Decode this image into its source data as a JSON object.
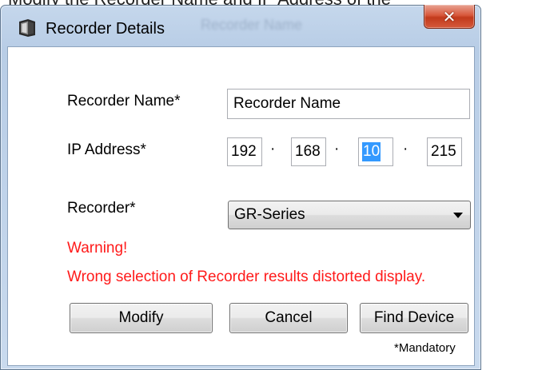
{
  "window": {
    "title": "Recorder Details",
    "close_glyph": "✕",
    "background_title": "Recorder Name"
  },
  "top_strip_text": "Modify the Recorder Name and IP Address of the",
  "form": {
    "recorder_name_label": "Recorder Name*",
    "recorder_name_value": "Recorder Name",
    "ip_label": "IP Address*",
    "ip_octets": [
      "192",
      "168",
      "10",
      "215"
    ],
    "ip_separator": "·",
    "recorder_label": "Recorder*",
    "recorder_selected": "GR-Series"
  },
  "warning": {
    "title": "Warning!",
    "message": "Wrong selection of Recorder results distorted display."
  },
  "buttons": {
    "modify": "Modify",
    "cancel": "Cancel",
    "find_device": "Find Device"
  },
  "footnote": "*Mandatory",
  "colors": {
    "warning": "#ff1a1a",
    "selection": "#3399ff",
    "close_button": "#c8432a"
  },
  "icons": {
    "app": "recorder-box-icon",
    "close": "close-icon",
    "dropdown": "chevron-down-icon"
  }
}
